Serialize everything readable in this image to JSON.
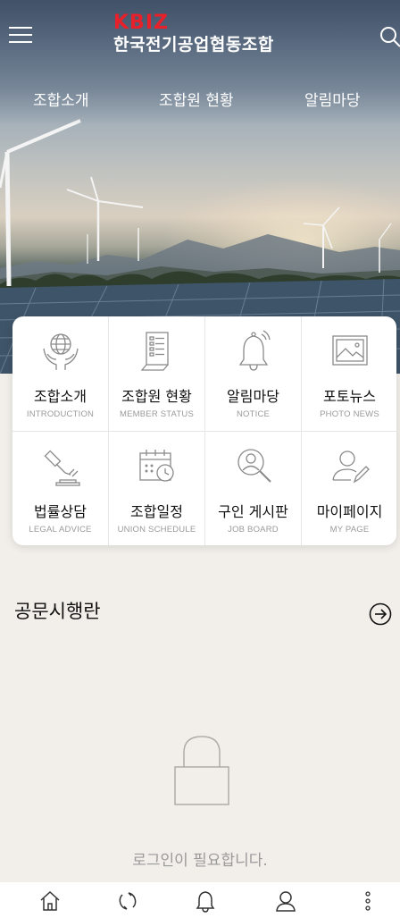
{
  "header": {
    "logo_brand": "KBIZ",
    "logo_name": "한국전기공업협동조합",
    "icons": {
      "menu": "hamburger-menu-icon",
      "search": "search-icon"
    }
  },
  "nav": {
    "items": [
      {
        "label": "조합소개"
      },
      {
        "label": "조합원 현황"
      },
      {
        "label": "알림마당"
      }
    ]
  },
  "menu_grid": {
    "items": [
      {
        "kr": "조합소개",
        "en": "INTRODUCTION",
        "icon": "globe-hands-icon"
      },
      {
        "kr": "조합원 현황",
        "en": "MEMBER STATUS",
        "icon": "document-list-icon"
      },
      {
        "kr": "알림마당",
        "en": "NOTICE",
        "icon": "bell-icon"
      },
      {
        "kr": "포토뉴스",
        "en": "PHOTO NEWS",
        "icon": "photo-icon"
      },
      {
        "kr": "법률상담",
        "en": "LEGAL ADVICE",
        "icon": "gavel-icon"
      },
      {
        "kr": "조합일정",
        "en": "UNION SCHEDULE",
        "icon": "calendar-icon"
      },
      {
        "kr": "구인 게시판",
        "en": "JOB BOARD",
        "icon": "magnifier-person-icon"
      },
      {
        "kr": "마이페이지",
        "en": "MY PAGE",
        "icon": "user-edit-icon"
      }
    ]
  },
  "notice_section": {
    "title": "공문시행란",
    "login_required": "로그인이 필요합니다.",
    "icons": {
      "more": "arrow-right-circle-icon",
      "lock": "lock-icon"
    }
  },
  "bottom_nav": {
    "icons": [
      "home-icon",
      "refresh-icon",
      "bell-icon",
      "user-icon",
      "more-vertical-icon"
    ]
  },
  "colors": {
    "brand_red": "#e8202a",
    "background": "#f2efea",
    "card": "#ffffff",
    "muted_text": "#9a9a9a"
  }
}
